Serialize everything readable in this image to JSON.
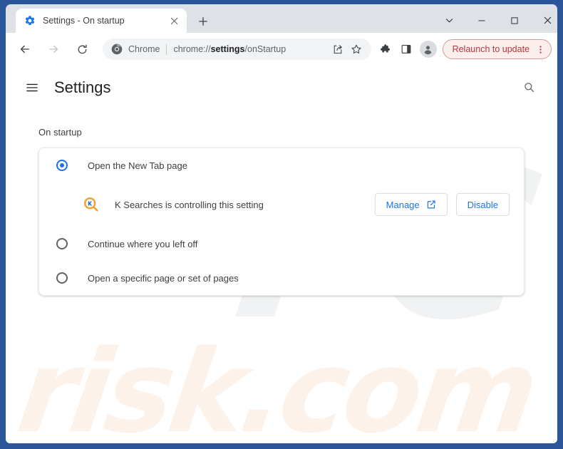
{
  "window": {
    "controls": {
      "tab_search_icon": "chevron-down-icon",
      "minimize_icon": "minimize-icon",
      "maximize_icon": "maximize-icon",
      "close_icon": "close-icon"
    },
    "border_color": "#2a5699"
  },
  "tabstrip": {
    "tab": {
      "favicon": "settings-gear-icon",
      "title": "Settings - On startup",
      "close_icon": "close-icon"
    },
    "new_tab_label": "+",
    "new_tab_icon": "plus-icon"
  },
  "toolbar": {
    "back_icon": "arrow-left-icon",
    "forward_icon": "arrow-right-icon",
    "reload_icon": "reload-icon",
    "omnibox": {
      "chip_icon": "chrome-logo-icon",
      "chip_label": "Chrome",
      "url_prefix": "chrome://",
      "url_bold": "settings",
      "url_suffix": "/onStartup"
    },
    "share_icon": "share-icon",
    "bookmark_icon": "star-icon",
    "extensions_icon": "puzzle-piece-icon",
    "side_panel_icon": "side-panel-icon",
    "profile_icon": "person-avatar-icon",
    "relaunch": {
      "label": "Relaunch to update",
      "menu_icon": "three-dots-vertical-icon",
      "text_color": "#b03a3a",
      "bg_color": "#fdeeee",
      "border_color": "#d49a9a"
    }
  },
  "settings_page": {
    "menu_icon": "hamburger-menu-icon",
    "title": "Settings",
    "search_icon": "search-icon",
    "section_label": "On startup",
    "card": {
      "options": [
        {
          "label": "Open the New Tab page",
          "selected": true
        },
        {
          "label": "Continue where you left off",
          "selected": false
        },
        {
          "label": "Open a specific page or set of pages",
          "selected": false
        }
      ],
      "controlled_notice": {
        "icon": "k-searches-magnifier-icon",
        "text": "K Searches is controlling this setting",
        "manage_label": "Manage",
        "manage_icon": "open-in-new-icon",
        "disable_label": "Disable"
      }
    },
    "accent_color": "#1a73e8"
  },
  "watermark": {
    "primary": "PC",
    "secondary": "risk.com",
    "primary_color": "#f1f2f3",
    "secondary_color": "#fdf2e9"
  }
}
